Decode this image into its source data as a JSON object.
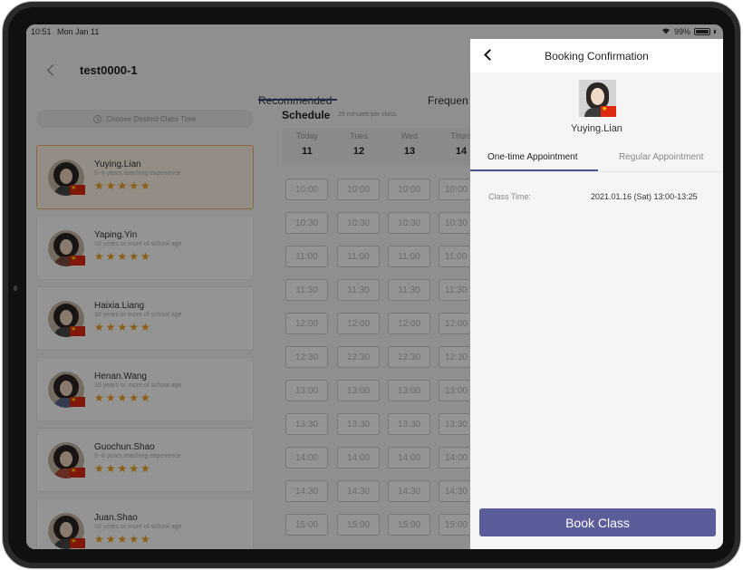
{
  "status_bar": {
    "time": "10:51",
    "date": "Mon Jan 11",
    "battery": "99%"
  },
  "background": {
    "page_title": "test0000-1",
    "tabs": [
      "Recommended",
      "Frequen"
    ],
    "desired_time": "Choose Desired Class Time",
    "schedule_title": "Schedule",
    "schedule_sub": "25 minutes per class",
    "days": [
      {
        "name": "Today",
        "num": "11"
      },
      {
        "name": "Tues",
        "num": "12"
      },
      {
        "name": "Wed",
        "num": "13"
      },
      {
        "name": "Thurs",
        "num": "14"
      }
    ],
    "slots": [
      "10:00",
      "10:30",
      "11:00",
      "11:30",
      "12:00",
      "12:30",
      "13:00",
      "13:30",
      "14:00",
      "14:30",
      "15:00"
    ],
    "teachers": [
      {
        "name": "Yuying.Lian",
        "exp": "5~8 years teaching experience",
        "stars": "★★★★★"
      },
      {
        "name": "Yaping.Yin",
        "exp": "10 years or more of school age",
        "stars": "★★★★★"
      },
      {
        "name": "Haixia.Liang",
        "exp": "10 years or more of school age",
        "stars": "★★★★★"
      },
      {
        "name": "Henan.Wang",
        "exp": "10 years or more of school age",
        "stars": "★★★★★"
      },
      {
        "name": "Guochun.Shao",
        "exp": "5~8 years teaching experience",
        "stars": "★★★★★"
      },
      {
        "name": "Juan.Shao",
        "exp": "10 years or more of school age",
        "stars": "★★★★★"
      }
    ]
  },
  "panel": {
    "title": "Booking Confirmation",
    "teacher_name": "Yuying.Lian",
    "tab_one_time": "One-time Appointment",
    "tab_regular": "Regular Appointment",
    "class_time_label": "Class Time:",
    "class_time_value": "2021.01.16 (Sat) 13:00-13:25",
    "book_button": "Book Class",
    "accent_color": "#5b5d9b"
  }
}
